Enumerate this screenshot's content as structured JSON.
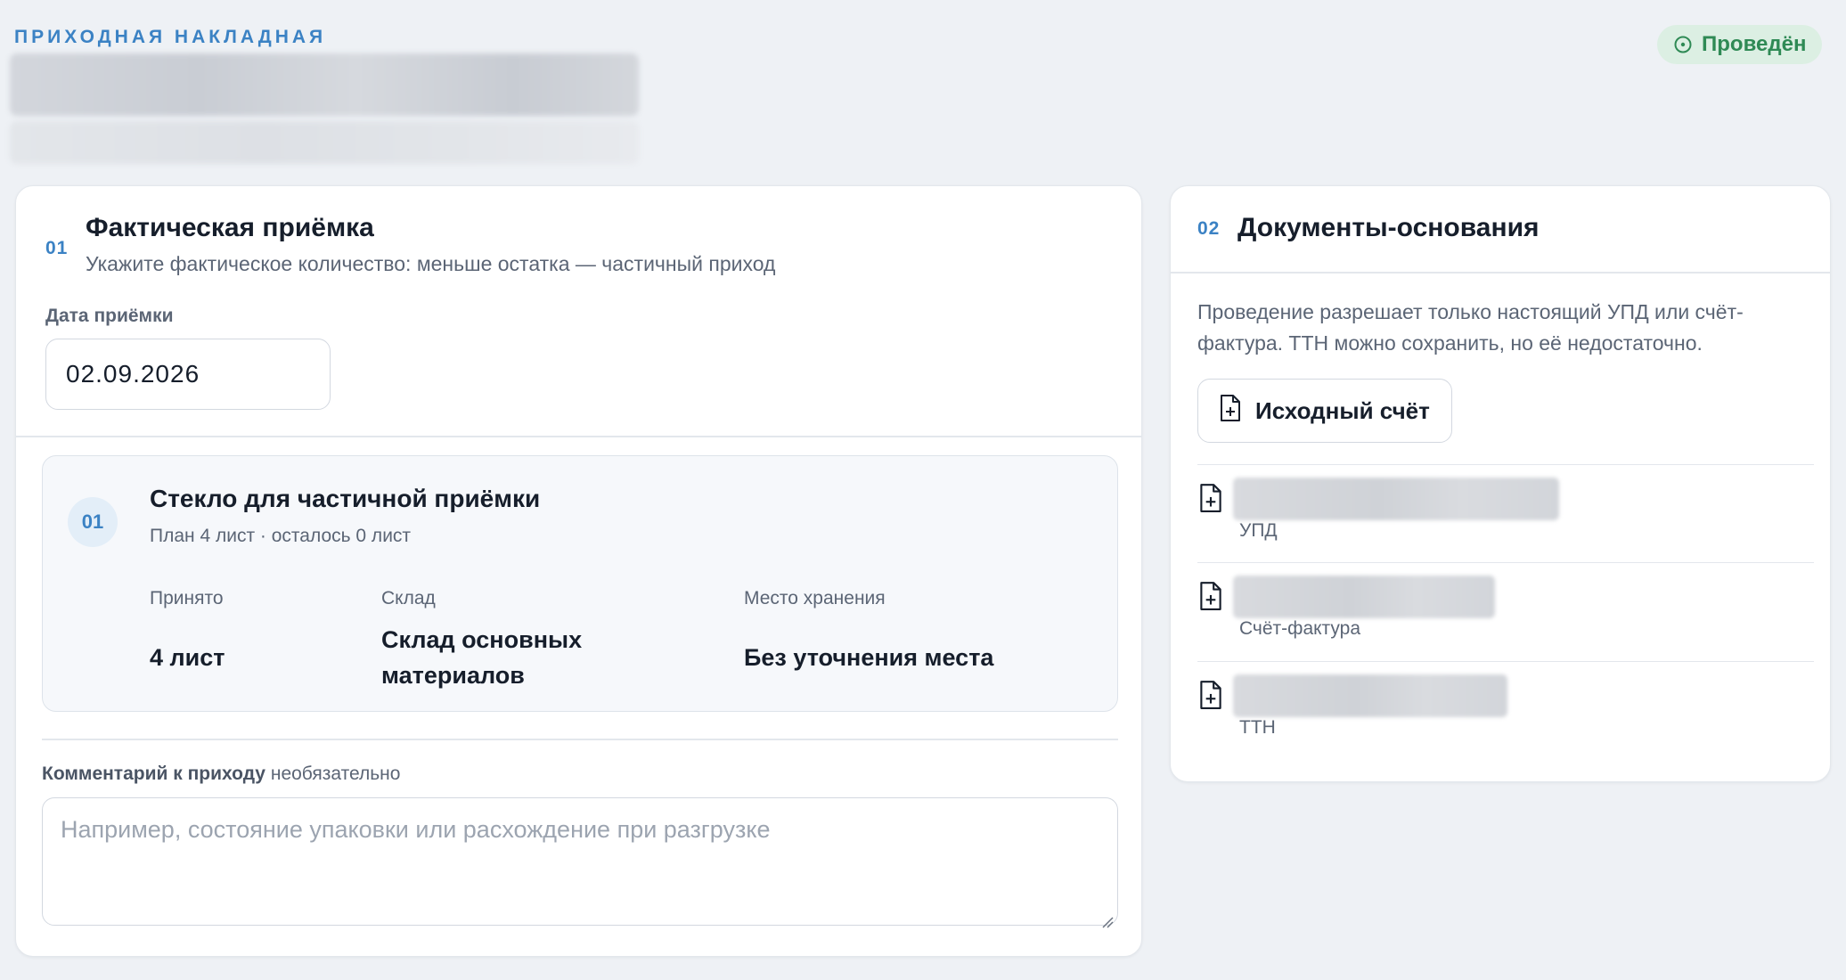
{
  "header": {
    "kicker": "ПРИХОДНАЯ НАКЛАДНАЯ",
    "status": "Проведён",
    "status_color": "#2f8a55"
  },
  "receipt": {
    "number": "01",
    "title": "Фактическая приёмка",
    "description": "Укажите фактическое количество: меньше остатка — частичный приход",
    "date_label": "Дата приёмки",
    "date_value": "02.09.2026",
    "item": {
      "number": "01",
      "title": "Стекло для частичной приёмки",
      "plan": "План 4 лист · осталось 0 лист",
      "accepted_label": "Принято",
      "accepted_value": "4 лист",
      "warehouse_label": "Склад",
      "warehouse_value": "Склад основных материалов",
      "location_label": "Место хранения",
      "location_value": "Без уточнения места"
    },
    "comment_label": "Комментарий к приходу",
    "comment_optional": "необязательно",
    "comment_placeholder": "Например, состояние упаковки или расхождение при разгрузке"
  },
  "documents": {
    "number": "02",
    "title": "Документы-основания",
    "description": "Проведение разрешает только настоящий УПД или счёт-фактура. ТТН можно сохранить, но её недостаточно.",
    "source_button": "Исходный счёт",
    "items": [
      {
        "type": "УПД",
        "icon": "file-plus-icon"
      },
      {
        "type": "Счёт-фактура",
        "icon": "file-plus-icon"
      },
      {
        "type": "ТТН",
        "icon": "file-plus-icon"
      }
    ]
  },
  "colors": {
    "accent": "#3b82c4",
    "background": "#eef1f5",
    "success_bg": "#dcefe3"
  }
}
